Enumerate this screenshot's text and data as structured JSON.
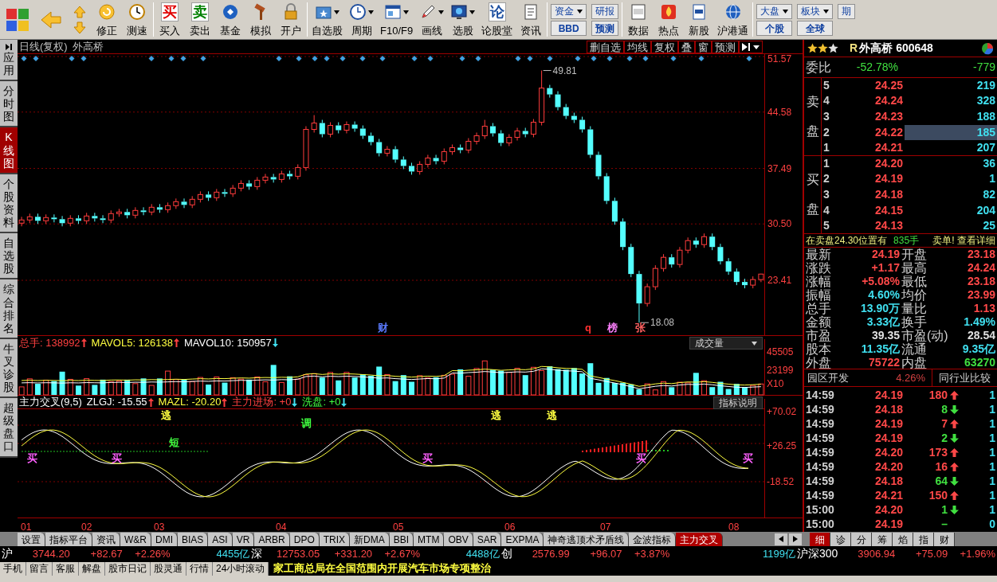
{
  "toolbar": {
    "groups": [
      [
        {
          "kind": "tool",
          "label": "修正",
          "dropdown": false
        },
        {
          "kind": "tool",
          "label": "测速",
          "dropdown": false
        }
      ],
      [
        {
          "kind": "glyph",
          "glyph": "买",
          "color": "#e00000",
          "label": "买入"
        },
        {
          "kind": "glyph",
          "glyph": "卖",
          "color": "#008000",
          "label": "卖出"
        },
        {
          "kind": "tool",
          "label": "基金",
          "dropdown": false
        },
        {
          "kind": "tool",
          "label": "模拟",
          "dropdown": false
        },
        {
          "kind": "tool",
          "label": "开户",
          "dropdown": false
        }
      ],
      [
        {
          "kind": "tool",
          "label": "自选股",
          "dropdown": true
        },
        {
          "kind": "tool",
          "label": "周期",
          "dropdown": true
        },
        {
          "kind": "tool",
          "label": "F10/F9",
          "dropdown": true
        },
        {
          "kind": "tool",
          "label": "画线",
          "dropdown": true
        },
        {
          "kind": "tool",
          "label": "选股",
          "dropdown": true
        },
        {
          "kind": "glyph",
          "glyph": "论",
          "color": "#1e50a0",
          "label": "论股堂"
        },
        {
          "kind": "tool",
          "label": "资讯",
          "dropdown": false
        }
      ],
      [
        {
          "kind": "pair",
          "top": "资金",
          "bottom": "BBD",
          "dropdown": true
        },
        {
          "kind": "pair",
          "top": "研报",
          "bottom": "预测",
          "dropdown": false
        }
      ],
      [
        {
          "kind": "tool",
          "label": "数据",
          "dropdown": false
        },
        {
          "kind": "tool",
          "label": "热点",
          "dropdown": false
        },
        {
          "kind": "tool",
          "label": "新股",
          "dropdown": false
        },
        {
          "kind": "tool",
          "label": "沪港通",
          "dropdown": false
        }
      ],
      [
        {
          "kind": "pair",
          "top": "大盘",
          "bottom": "个股",
          "dropdown": true
        },
        {
          "kind": "pair",
          "top": "板块",
          "bottom": "全球",
          "dropdown": true
        },
        {
          "kind": "pair",
          "top": "期",
          "dropdown": false
        }
      ]
    ]
  },
  "sidebar": [
    {
      "label": "应用",
      "selected": false
    },
    {
      "label": "分时图",
      "selected": false
    },
    {
      "label": "K线图",
      "selected": true
    },
    {
      "label": "个股资料",
      "selected": false
    },
    {
      "label": "自选股",
      "selected": false
    },
    {
      "label": "综合排名",
      "selected": false
    },
    {
      "label": "牛叉诊股",
      "selected": false
    },
    {
      "label": "超级盘口",
      "selected": false
    }
  ],
  "chart": {
    "title": "日线(复权)",
    "stock": "外高桥",
    "buttons": [
      "删自选",
      "均线",
      "复权",
      "叠",
      "窗",
      "预测"
    ],
    "chart_data": {
      "type": "candlestick",
      "categories": [
        null,
        null,
        null,
        null,
        null,
        null,
        null,
        null,
        null,
        null,
        null,
        null,
        null,
        null,
        null,
        null,
        null,
        null,
        null,
        null,
        null,
        null,
        null,
        null,
        null,
        null,
        null,
        null,
        null,
        null,
        null,
        null,
        null,
        null,
        null,
        null,
        null,
        null,
        null,
        null,
        null,
        null,
        null,
        null,
        null,
        null,
        null,
        null,
        null,
        null,
        null,
        null,
        null,
        null,
        null,
        null,
        null,
        null,
        null,
        null,
        null,
        null,
        null,
        null,
        null,
        null,
        null,
        null,
        null,
        null,
        null,
        null,
        null,
        null,
        null,
        null,
        null,
        null,
        null,
        null,
        null,
        null,
        null,
        null,
        null,
        null,
        null,
        null,
        null,
        null,
        null,
        null
      ],
      "ohlc": [
        [
          30.6,
          31.4,
          30.2,
          31.0
        ],
        [
          31.0,
          31.8,
          30.6,
          31.4
        ],
        [
          31.4,
          31.8,
          30.5,
          30.9
        ],
        [
          30.9,
          31.7,
          30.5,
          31.3
        ],
        [
          31.3,
          31.7,
          30.7,
          31.1
        ],
        [
          31.1,
          31.5,
          30.2,
          30.6
        ],
        [
          30.6,
          31.6,
          30.2,
          31.2
        ],
        [
          31.2,
          31.6,
          30.5,
          30.9
        ],
        [
          30.9,
          31.9,
          30.5,
          31.5
        ],
        [
          31.5,
          31.9,
          30.8,
          31.2
        ],
        [
          31.2,
          31.6,
          30.6,
          31.0
        ],
        [
          31.0,
          32.2,
          30.6,
          31.8
        ],
        [
          31.8,
          32.4,
          31.4,
          32.0
        ],
        [
          32.0,
          32.4,
          31.2,
          31.6
        ],
        [
          31.6,
          32.6,
          31.2,
          32.2
        ],
        [
          32.2,
          32.6,
          31.6,
          32.0
        ],
        [
          32.0,
          33.0,
          31.6,
          32.6
        ],
        [
          32.6,
          33.0,
          31.9,
          32.3
        ],
        [
          32.3,
          33.2,
          31.9,
          32.8
        ],
        [
          32.8,
          33.7,
          32.4,
          33.3
        ],
        [
          33.3,
          33.7,
          32.5,
          32.9
        ],
        [
          32.9,
          34.0,
          32.5,
          33.6
        ],
        [
          33.6,
          34.6,
          33.2,
          34.2
        ],
        [
          34.2,
          34.6,
          33.4,
          33.8
        ],
        [
          33.8,
          34.9,
          33.4,
          34.5
        ],
        [
          34.5,
          34.9,
          33.9,
          34.3
        ],
        [
          34.3,
          35.4,
          33.9,
          35.0
        ],
        [
          35.0,
          36.0,
          34.6,
          35.6
        ],
        [
          35.6,
          36.0,
          34.8,
          35.2
        ],
        [
          35.2,
          36.4,
          34.8,
          36.0
        ],
        [
          36.0,
          36.8,
          35.6,
          36.4
        ],
        [
          36.4,
          36.8,
          35.7,
          36.1
        ],
        [
          36.1,
          37.2,
          35.7,
          36.8
        ],
        [
          36.8,
          37.2,
          36.1,
          36.5
        ],
        [
          36.5,
          38.0,
          36.1,
          37.6
        ],
        [
          37.6,
          42.8,
          37.2,
          42.4
        ],
        [
          42.4,
          44.2,
          42.0,
          43.2
        ],
        [
          43.2,
          43.6,
          41.4,
          41.8
        ],
        [
          41.8,
          43.3,
          41.4,
          42.9
        ],
        [
          42.9,
          43.3,
          41.9,
          42.3
        ],
        [
          42.3,
          43.4,
          41.9,
          43.0
        ],
        [
          43.0,
          43.4,
          42.1,
          42.5
        ],
        [
          42.5,
          42.9,
          41.2,
          41.6
        ],
        [
          41.6,
          42.0,
          40.4,
          40.8
        ],
        [
          40.8,
          41.2,
          39.0,
          39.4
        ],
        [
          39.4,
          40.3,
          39.0,
          39.9
        ],
        [
          39.9,
          40.3,
          38.2,
          38.6
        ],
        [
          38.6,
          39.0,
          37.4,
          37.8
        ],
        [
          37.8,
          38.2,
          36.7,
          37.1
        ],
        [
          37.1,
          38.4,
          36.7,
          38.0
        ],
        [
          38.0,
          39.2,
          37.6,
          38.8
        ],
        [
          38.8,
          39.2,
          38.0,
          38.4
        ],
        [
          38.4,
          40.0,
          38.0,
          39.6
        ],
        [
          39.6,
          40.5,
          39.2,
          40.1
        ],
        [
          40.1,
          40.5,
          39.4,
          39.8
        ],
        [
          39.8,
          41.3,
          39.4,
          40.9
        ],
        [
          40.9,
          42.0,
          40.5,
          41.6
        ],
        [
          41.6,
          43.6,
          41.2,
          42.8
        ],
        [
          42.8,
          43.2,
          41.5,
          41.9
        ],
        [
          41.9,
          42.3,
          40.3,
          40.7
        ],
        [
          40.7,
          41.8,
          40.3,
          41.4
        ],
        [
          41.4,
          42.6,
          41.0,
          42.2
        ],
        [
          42.2,
          42.6,
          41.4,
          41.8
        ],
        [
          41.8,
          43.7,
          41.4,
          43.3
        ],
        [
          43.3,
          49.81,
          42.9,
          47.6
        ],
        [
          47.6,
          48.0,
          46.4,
          46.8
        ],
        [
          46.8,
          47.2,
          44.8,
          45.2
        ],
        [
          45.2,
          45.6,
          43.7,
          44.1
        ],
        [
          44.1,
          44.5,
          43.2,
          43.6
        ],
        [
          43.6,
          44.0,
          42.0,
          42.4
        ],
        [
          42.4,
          42.8,
          38.8,
          39.2
        ],
        [
          39.2,
          39.6,
          36.1,
          36.5
        ],
        [
          36.5,
          36.9,
          33.0,
          33.4
        ],
        [
          33.4,
          33.8,
          30.4,
          30.8
        ],
        [
          30.8,
          31.2,
          27.2,
          27.6
        ],
        [
          27.6,
          28.0,
          23.8,
          24.2
        ],
        [
          24.2,
          24.6,
          18.08,
          20.5
        ],
        [
          20.5,
          23.0,
          20.1,
          22.6
        ],
        [
          22.6,
          25.3,
          22.2,
          24.9
        ],
        [
          24.9,
          26.7,
          24.5,
          26.3
        ],
        [
          26.3,
          26.7,
          25.0,
          25.4
        ],
        [
          25.4,
          27.6,
          25.0,
          27.2
        ],
        [
          27.2,
          28.8,
          26.8,
          28.4
        ],
        [
          28.4,
          28.8,
          27.5,
          27.9
        ],
        [
          27.9,
          29.3,
          27.5,
          28.9
        ],
        [
          28.9,
          29.3,
          27.2,
          27.6
        ],
        [
          27.6,
          28.0,
          25.4,
          25.8
        ],
        [
          25.8,
          26.2,
          24.1,
          24.5
        ],
        [
          24.5,
          24.9,
          22.8,
          23.2
        ],
        [
          23.2,
          23.6,
          22.4,
          22.8
        ],
        [
          22.8,
          23.9,
          22.4,
          23.5
        ],
        [
          23.5,
          24.24,
          23.18,
          24.19
        ]
      ],
      "grid": true,
      "ylim": [
        16.4,
        51.87
      ],
      "yticks": [
        {
          "value": 51.57,
          "label": "51.57"
        },
        {
          "value": 44.58,
          "label": "44.58"
        },
        {
          "value": 37.49,
          "label": "37.49"
        },
        {
          "value": 30.5,
          "label": "30.50"
        },
        {
          "value": 23.41,
          "label": "23.41"
        }
      ]
    },
    "high_label": "49.81",
    "low_label": "18.08",
    "event_marks": [
      {
        "label": "财",
        "color": "#5a7aff"
      },
      {
        "label": "q",
        "color": "#ff3030"
      },
      {
        "label": "榜",
        "color": "#ff80ff"
      },
      {
        "label": "张",
        "color": "#ff6060"
      }
    ]
  },
  "volume": {
    "readouts": [
      {
        "text": "总手: 138992",
        "rising": true,
        "color": "#ff4040"
      },
      {
        "text": "MAVOL5: 126138",
        "rising": true,
        "color": "#ffff40"
      },
      {
        "text": "MAVOL10: 150957",
        "rising": false,
        "color": "#ffffff"
      }
    ],
    "selector": "成交量",
    "axis": [
      "45505",
      "23199",
      "X10"
    ]
  },
  "indicator": {
    "title": "主力交叉(9,5)",
    "readouts": [
      {
        "text": "ZLGJ: -15.55",
        "rising": true,
        "color": "#ffffff"
      },
      {
        "text": "MAZL: -20.20",
        "rising": true,
        "color": "#ffff40"
      },
      {
        "text": "主力进场: +0",
        "rising": false,
        "color": "#ff4040"
      },
      {
        "text": "洗盘: +0",
        "rising": false,
        "color": "#40ff40"
      }
    ],
    "button": "指标说明",
    "axis": [
      "+70.02",
      "+26.25",
      "-18.52"
    ],
    "signals": [
      {
        "label": "买",
        "color": "#ff60ff"
      },
      {
        "label": "买",
        "color": "#ff60ff"
      },
      {
        "label": "逃",
        "color": "#ffff40"
      },
      {
        "label": "短",
        "color": "#40ff40"
      },
      {
        "label": "调",
        "color": "#40ff40"
      },
      {
        "label": "买",
        "color": "#ff60ff"
      },
      {
        "label": "逃",
        "color": "#ffff40"
      },
      {
        "label": "逃",
        "color": "#ffff40"
      },
      {
        "label": "买",
        "color": "#ff60ff"
      },
      {
        "label": "买",
        "color": "#ff60ff"
      }
    ]
  },
  "date_axis": [
    "01",
    "02",
    "03",
    "04",
    "05",
    "06",
    "07",
    "08"
  ],
  "tabs": [
    {
      "label": "设置",
      "selected": false
    },
    {
      "label": "指标平台",
      "selected": false
    },
    {
      "label": "资讯",
      "selected": false
    },
    {
      "label": "W&R",
      "selected": false
    },
    {
      "label": "DMI",
      "selected": false
    },
    {
      "label": "BIAS",
      "selected": false
    },
    {
      "label": "ASI",
      "selected": false
    },
    {
      "label": "VR",
      "selected": false
    },
    {
      "label": "ARBR",
      "selected": false
    },
    {
      "label": "DPO",
      "selected": false
    },
    {
      "label": "TRIX",
      "selected": false
    },
    {
      "label": "新DMA",
      "selected": false
    },
    {
      "label": "BBI",
      "selected": false
    },
    {
      "label": "MTM",
      "selected": false
    },
    {
      "label": "OBV",
      "selected": false
    },
    {
      "label": "SAR",
      "selected": false
    },
    {
      "label": "EXPMA",
      "selected": false
    },
    {
      "label": "神奇逃顶术矛盾线",
      "selected": false
    },
    {
      "label": "金波指标",
      "selected": false
    },
    {
      "label": "主力交叉",
      "selected": true
    }
  ],
  "quote": {
    "stars": 2,
    "flag": "R",
    "name": "外高桥",
    "code": "600648",
    "ratio": {
      "label": "委比",
      "percent": "-52.78%",
      "diff": "-779"
    },
    "ask_label": "卖盘",
    "asks": [
      {
        "level": "5",
        "price": "24.25",
        "volume": "219",
        "selected": false
      },
      {
        "level": "4",
        "price": "24.24",
        "volume": "328",
        "selected": false
      },
      {
        "level": "3",
        "price": "24.23",
        "volume": "188",
        "selected": false
      },
      {
        "level": "2",
        "price": "24.22",
        "volume": "185",
        "selected": true
      },
      {
        "level": "1",
        "price": "24.21",
        "volume": "207",
        "selected": false
      }
    ],
    "bid_label": "买盘",
    "bids": [
      {
        "level": "1",
        "price": "24.20",
        "volume": "36"
      },
      {
        "level": "2",
        "price": "24.19",
        "volume": "1"
      },
      {
        "level": "3",
        "price": "24.18",
        "volume": "82"
      },
      {
        "level": "4",
        "price": "24.15",
        "volume": "204"
      },
      {
        "level": "5",
        "price": "24.13",
        "volume": "25"
      }
    ],
    "alert": {
      "text": "在卖盘24.30位置有",
      "volume": "835手",
      "action": "卖单! 查看详细"
    },
    "stats": [
      {
        "label": "最新",
        "value": "24.19",
        "color": "#ff4848"
      },
      {
        "label": "开盘",
        "value": "23.18",
        "color": "#ff4848"
      },
      {
        "label": "涨跌",
        "value": "+1.17",
        "color": "#ff4848"
      },
      {
        "label": "最高",
        "value": "24.24",
        "color": "#ff4848"
      },
      {
        "label": "涨幅",
        "value": "+5.08%",
        "color": "#ff4848"
      },
      {
        "label": "最低",
        "value": "23.18",
        "color": "#ff4848"
      },
      {
        "label": "振幅",
        "value": "4.60%",
        "color": "#40e0f0"
      },
      {
        "label": "均价",
        "value": "23.99",
        "color": "#ff4848"
      },
      {
        "label": "总手",
        "value": "13.90万",
        "color": "#40e0f0"
      },
      {
        "label": "量比",
        "value": "1.13",
        "color": "#ff4848"
      },
      {
        "label": "金额",
        "value": "3.33亿",
        "color": "#40e0f0"
      },
      {
        "label": "换手",
        "value": "1.49%",
        "color": "#40e0f0"
      },
      {
        "label": "市盈",
        "value": "39.35",
        "color": "#e0e0e0"
      },
      {
        "label": "市盈(动)",
        "value": "28.54",
        "color": "#e0e0e0"
      },
      {
        "label": "股本",
        "value": "11.35亿",
        "color": "#40e0f0"
      },
      {
        "label": "流通",
        "value": "9.35亿",
        "color": "#40e0f0"
      },
      {
        "label": "外盘",
        "value": "75722",
        "color": "#ff4848"
      },
      {
        "label": "内盘",
        "value": "63270",
        "color": "#40e040"
      }
    ],
    "sector": {
      "name": "园区开发",
      "change": "4.26%",
      "button": "同行业比较"
    },
    "ticks": [
      {
        "time": "14:59",
        "price": "24.19",
        "volume": "180",
        "rising": true,
        "column_5": "1"
      },
      {
        "time": "14:59",
        "price": "24.18",
        "volume": "8",
        "rising": false,
        "column_5": "1"
      },
      {
        "time": "14:59",
        "price": "24.19",
        "volume": "7",
        "rising": true,
        "column_5": "1"
      },
      {
        "time": "14:59",
        "price": "24.19",
        "volume": "2",
        "rising": false,
        "column_5": "1"
      },
      {
        "time": "14:59",
        "price": "24.20",
        "volume": "173",
        "rising": true,
        "column_5": "1"
      },
      {
        "time": "14:59",
        "price": "24.20",
        "volume": "16",
        "rising": true,
        "column_5": "1"
      },
      {
        "time": "14:59",
        "price": "24.18",
        "volume": "64",
        "rising": false,
        "column_5": "1"
      },
      {
        "time": "14:59",
        "price": "24.21",
        "volume": "150",
        "rising": true,
        "column_5": "1"
      },
      {
        "time": "15:00",
        "price": "24.20",
        "volume": "1",
        "rising": false,
        "column_5": "1"
      },
      {
        "time": "15:00",
        "price": "24.19",
        "volume": "–",
        "column_5": "0"
      }
    ],
    "tabs": [
      {
        "label": "细",
        "selected": true
      },
      {
        "label": "诊",
        "selected": false
      },
      {
        "label": "分",
        "selected": false
      },
      {
        "label": "筹",
        "selected": false
      },
      {
        "label": "焰",
        "selected": false
      },
      {
        "label": "指",
        "selected": false
      },
      {
        "label": "财",
        "selected": false
      }
    ]
  },
  "market": [
    {
      "name": "沪",
      "value": "3744.20",
      "change": "+82.67",
      "percent": "+2.26%",
      "amount": "4455亿"
    },
    {
      "name": "深",
      "value": "12753.05",
      "change": "+331.20",
      "percent": "+2.67%",
      "amount": "4488亿"
    },
    {
      "name": "创",
      "value": "2576.99",
      "change": "+96.07",
      "percent": "+3.87%",
      "amount": "1199亿"
    },
    {
      "name": "沪深300",
      "value": "3906.94",
      "change": "+75.09",
      "percent": "+1.96%"
    }
  ],
  "footer": {
    "links": [
      "手机",
      "留言",
      "客服",
      "解盘",
      "股市日记",
      "股灵通",
      "行情",
      "24小时滚动"
    ],
    "news": "家工商总局在全国范围内开展汽车市场专项整治"
  }
}
